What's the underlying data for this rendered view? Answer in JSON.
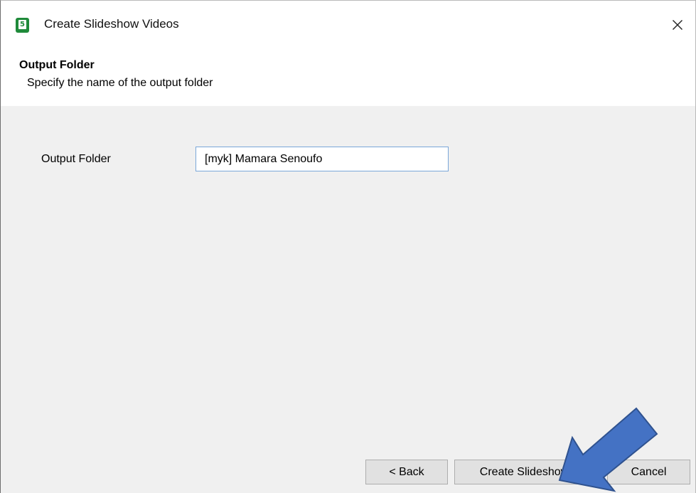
{
  "window": {
    "title": "Create Slideshow Videos",
    "app_icon_glyph": "5",
    "icon": "app-icon",
    "close_icon": "close-icon"
  },
  "header": {
    "title": "Output Folder",
    "subtitle": "Specify the name of the output folder"
  },
  "form": {
    "output_folder_label": "Output Folder",
    "output_folder_value": "[myk] Mamara Senoufo"
  },
  "buttons": {
    "back": "< Back",
    "create": "Create Slideshows",
    "cancel": "Cancel"
  },
  "annotation": {
    "icon": "arrow-icon",
    "color": "#4472c4"
  }
}
